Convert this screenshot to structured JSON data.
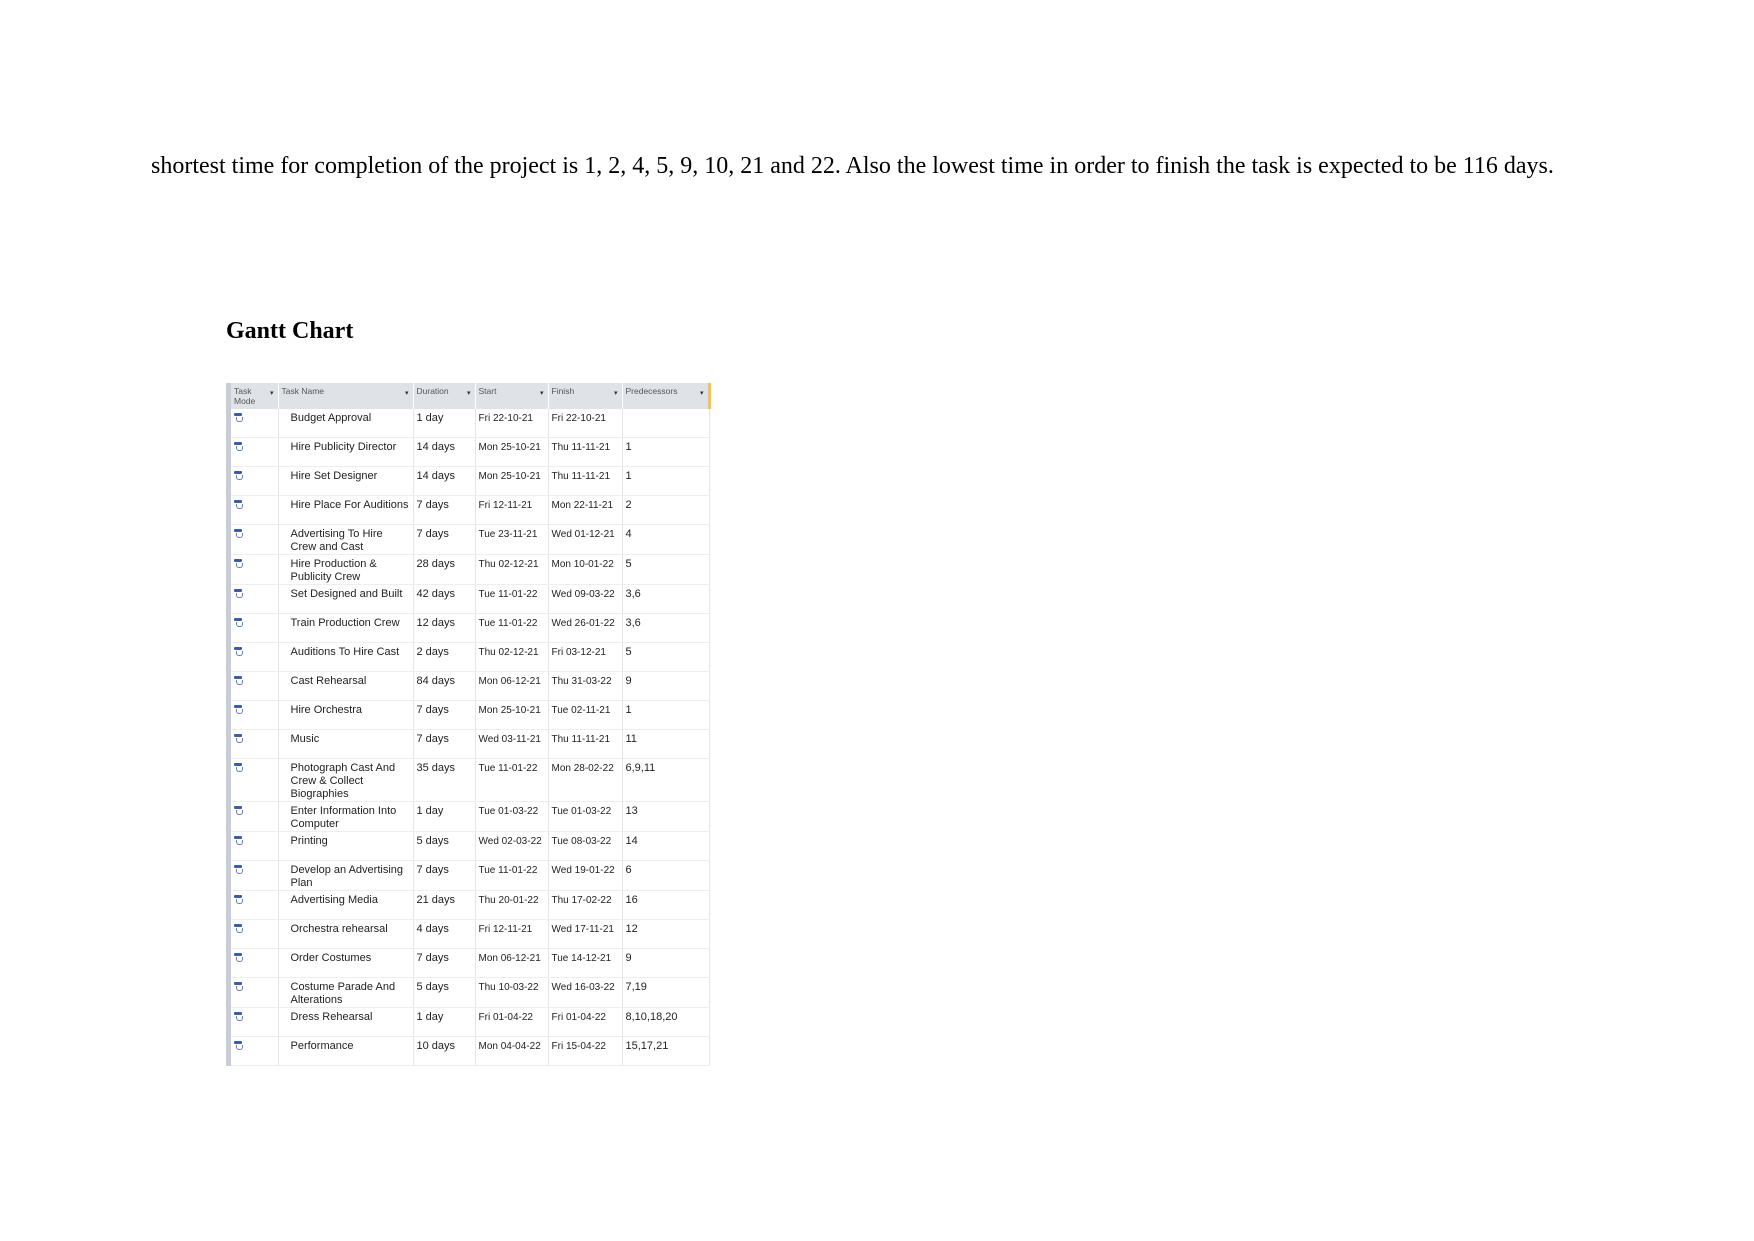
{
  "paragraph": "shortest time for completion of the project is 1, 2, 4, 5, 9, 10, 21 and 22. Also the lowest time in order to finish the task is expected to be 116 days.",
  "heading": "Gantt Chart",
  "table": {
    "columns": [
      "Task Mode",
      "Task Name",
      "Duration",
      "Start",
      "Finish",
      "Predecessors"
    ],
    "icon": "auto-scheduled-task-icon",
    "rows": [
      {
        "name": "Budget Approval",
        "duration": "1 day",
        "start": "Fri 22-10-21",
        "finish": "Fri 22-10-21",
        "pred": ""
      },
      {
        "name": "Hire Publicity Director",
        "duration": "14 days",
        "start": "Mon 25-10-21",
        "finish": "Thu 11-11-21",
        "pred": "1"
      },
      {
        "name": "Hire Set Designer",
        "duration": "14 days",
        "start": "Mon 25-10-21",
        "finish": "Thu 11-11-21",
        "pred": "1"
      },
      {
        "name": "Hire Place For Auditions",
        "duration": "7 days",
        "start": "Fri 12-11-21",
        "finish": "Mon 22-11-21",
        "pred": "2"
      },
      {
        "name": "Advertising To Hire Crew and Cast",
        "duration": "7 days",
        "start": "Tue 23-11-21",
        "finish": "Wed 01-12-21",
        "pred": "4"
      },
      {
        "name": "Hire Production & Publicity Crew",
        "duration": "28 days",
        "start": "Thu 02-12-21",
        "finish": "Mon 10-01-22",
        "pred": "5"
      },
      {
        "name": "Set Designed and Built",
        "duration": "42 days",
        "start": "Tue 11-01-22",
        "finish": "Wed 09-03-22",
        "pred": "3,6"
      },
      {
        "name": "Train Production Crew",
        "duration": "12 days",
        "start": "Tue 11-01-22",
        "finish": "Wed 26-01-22",
        "pred": "3,6"
      },
      {
        "name": "Auditions To Hire Cast",
        "duration": "2 days",
        "start": "Thu 02-12-21",
        "finish": "Fri 03-12-21",
        "pred": "5"
      },
      {
        "name": "Cast Rehearsal",
        "duration": "84 days",
        "start": "Mon 06-12-21",
        "finish": "Thu 31-03-22",
        "pred": "9"
      },
      {
        "name": "Hire Orchestra",
        "duration": "7 days",
        "start": "Mon 25-10-21",
        "finish": "Tue 02-11-21",
        "pred": "1"
      },
      {
        "name": "Music",
        "duration": "7 days",
        "start": "Wed 03-11-21",
        "finish": "Thu 11-11-21",
        "pred": "11"
      },
      {
        "name": "Photograph Cast And Crew & Collect Biographies",
        "duration": "35 days",
        "start": "Tue 11-01-22",
        "finish": "Mon 28-02-22",
        "pred": "6,9,11"
      },
      {
        "name": "Enter Information Into Computer",
        "duration": "1 day",
        "start": "Tue 01-03-22",
        "finish": "Tue 01-03-22",
        "pred": "13"
      },
      {
        "name": "Printing",
        "duration": "5 days",
        "start": "Wed 02-03-22",
        "finish": "Tue 08-03-22",
        "pred": "14"
      },
      {
        "name": "Develop an Advertising Plan",
        "duration": "7 days",
        "start": "Tue 11-01-22",
        "finish": "Wed 19-01-22",
        "pred": "6"
      },
      {
        "name": "Advertising Media",
        "duration": "21 days",
        "start": "Thu 20-01-22",
        "finish": "Thu 17-02-22",
        "pred": "16"
      },
      {
        "name": "Orchestra rehearsal",
        "duration": "4 days",
        "start": "Fri 12-11-21",
        "finish": "Wed 17-11-21",
        "pred": "12"
      },
      {
        "name": "Order Costumes",
        "duration": "7 days",
        "start": "Mon 06-12-21",
        "finish": "Tue 14-12-21",
        "pred": "9"
      },
      {
        "name": "Costume Parade And Alterations",
        "duration": "5 days",
        "start": "Thu 10-03-22",
        "finish": "Wed 16-03-22",
        "pred": "7,19"
      },
      {
        "name": "Dress Rehearsal",
        "duration": "1 day",
        "start": "Fri 01-04-22",
        "finish": "Fri 01-04-22",
        "pred": "8,10,18,20"
      },
      {
        "name": "Performance",
        "duration": "10 days",
        "start": "Mon 04-04-22",
        "finish": "Fri 15-04-22",
        "pred": "15,17,21"
      }
    ]
  }
}
